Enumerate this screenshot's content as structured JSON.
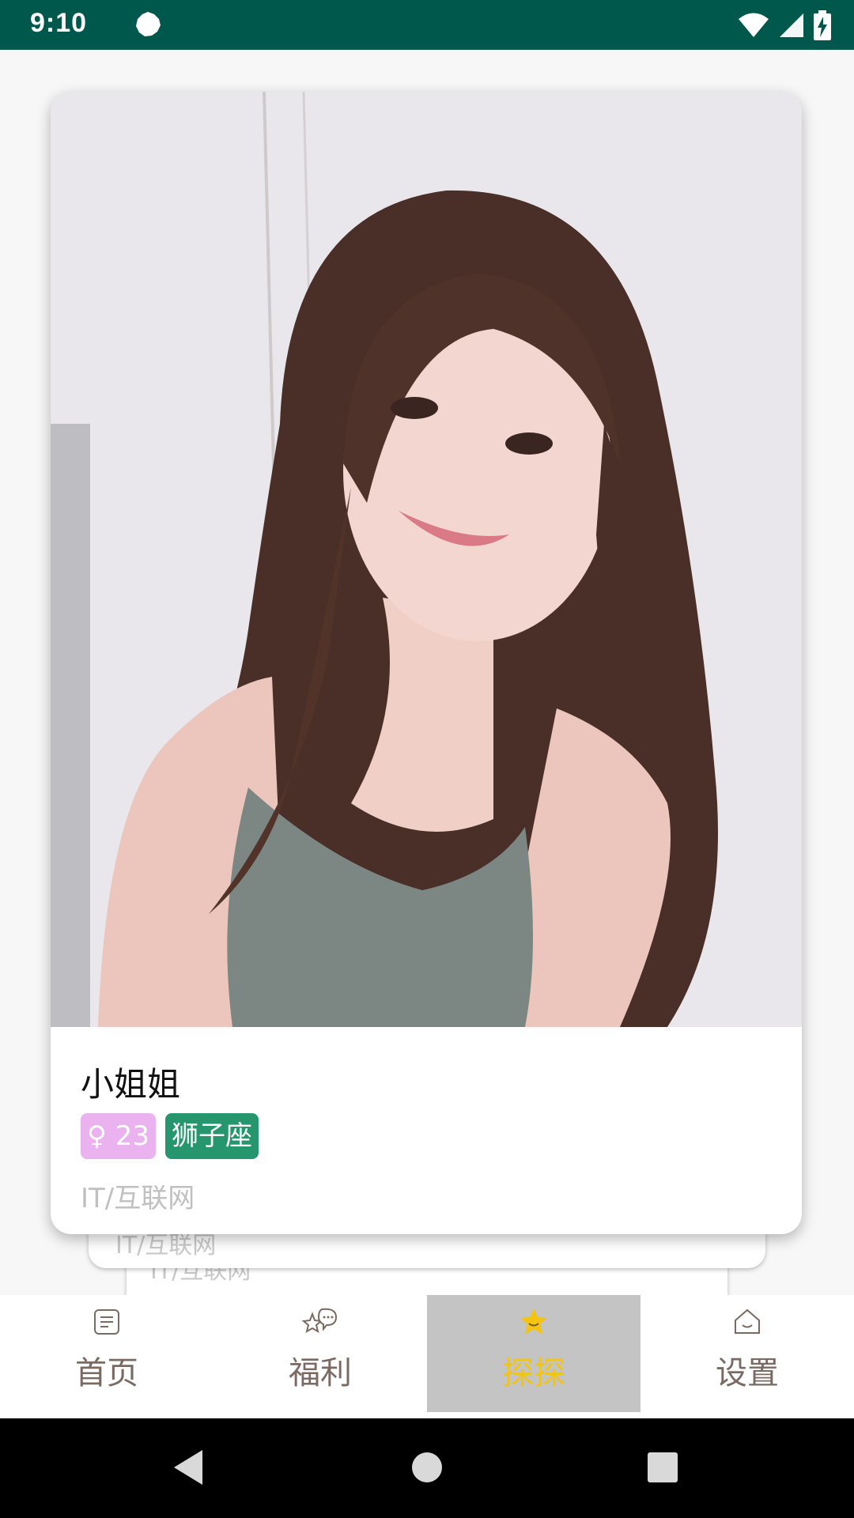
{
  "status_bar": {
    "time": "9:10",
    "notification_icon": "android-settings-icon",
    "wifi_icon": "wifi-icon",
    "signal_icon": "signal-icon",
    "battery_icon": "battery-charging-icon"
  },
  "card": {
    "photo_alt": "profile-photo",
    "name": "小姐姐",
    "age_tag": "♀ 23",
    "zodiac_tag": "狮子座",
    "job": "IT/互联网",
    "age_tag_color": "#eab2ee",
    "zodiac_tag_color": "#26966f"
  },
  "stack_cards": [
    {
      "job": "IT/互联网"
    },
    {
      "job": "IT/互联网"
    }
  ],
  "bottom_nav": {
    "items": [
      {
        "label": "首页",
        "icon": "list-icon",
        "active": false
      },
      {
        "label": "福利",
        "icon": "chat-star-icon",
        "active": false
      },
      {
        "label": "探探",
        "icon": "star-icon",
        "active": true
      },
      {
        "label": "设置",
        "icon": "home-smile-icon",
        "active": false
      }
    ],
    "active_color": "#f3c511",
    "inactive_color": "#7a6a62"
  },
  "system_nav": {
    "back_icon": "back-triangle-icon",
    "home_icon": "home-circle-icon",
    "recents_icon": "recents-square-icon"
  }
}
